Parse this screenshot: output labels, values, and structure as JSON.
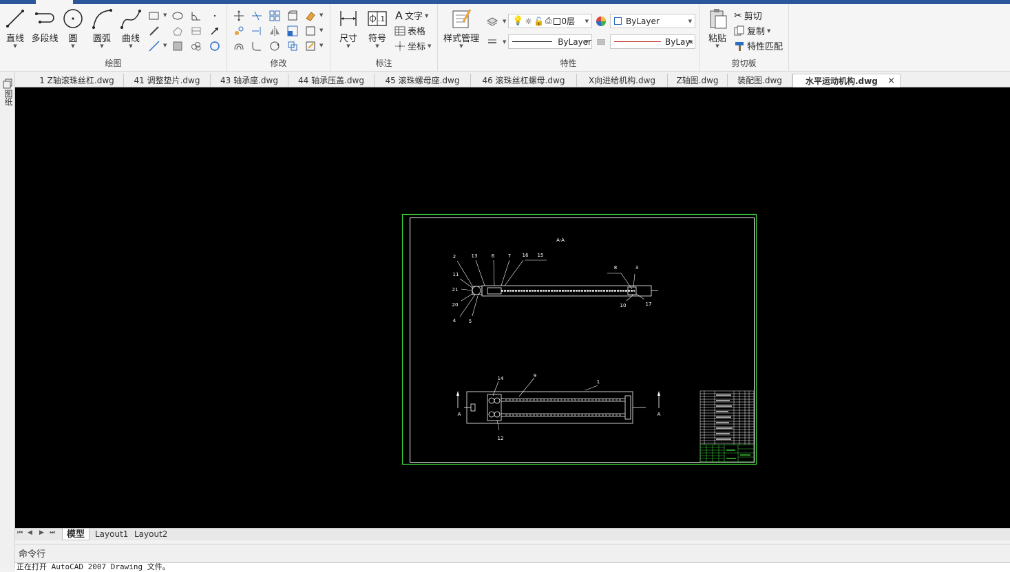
{
  "ribbon": {
    "draw": {
      "label": "绘图",
      "line": "直线",
      "polyline": "多段线",
      "circle": "圆",
      "arc": "圆弧",
      "curve": "曲线"
    },
    "modify": {
      "label": "修改"
    },
    "annotation": {
      "label": "标注",
      "dimension": "尺寸",
      "symbol": "符号",
      "text": "文字",
      "table": "表格",
      "coordinate": "坐标"
    },
    "style": {
      "label": "样式管理"
    },
    "properties": {
      "label": "特性",
      "layer_value": "0层",
      "color_value": "ByLayer",
      "linetype_value": "ByLayer",
      "lineweight_value": "ByLay‹"
    },
    "clipboard": {
      "label": "剪切板",
      "paste": "粘贴",
      "cut": "剪切",
      "copy": "复制",
      "match": "特性匹配"
    }
  },
  "left_toolbar": {
    "label": "图纸"
  },
  "doc_tabs": [
    "1 Z轴滚珠丝杠.dwg",
    "41 调整垫片.dwg",
    "43 轴承座.dwg",
    "44 轴承压盖.dwg",
    "45 滚珠螺母座.dwg",
    "46 滚珠丝杠螺母.dwg",
    "X向进给机构.dwg",
    "Z轴图.dwg",
    "装配图.dwg",
    "水平运动机构.dwg"
  ],
  "active_close": "×",
  "drawing": {
    "section_title": "A-A",
    "top_numbers": [
      "2",
      "13",
      "6",
      "7",
      "16",
      "15",
      "8",
      "3",
      "11",
      "21",
      "20",
      "4",
      "5",
      "10",
      "17"
    ],
    "bottom_numbers": [
      "14",
      "9",
      "1",
      "12"
    ],
    "section_marks": [
      "A",
      "A"
    ]
  },
  "layout_tabs": {
    "model": "模型",
    "layout1": "Layout1",
    "layout2": "Layout2"
  },
  "command": {
    "label": "命令行",
    "output": "正在打开 AutoCAD 2007 Drawing 文件。"
  }
}
